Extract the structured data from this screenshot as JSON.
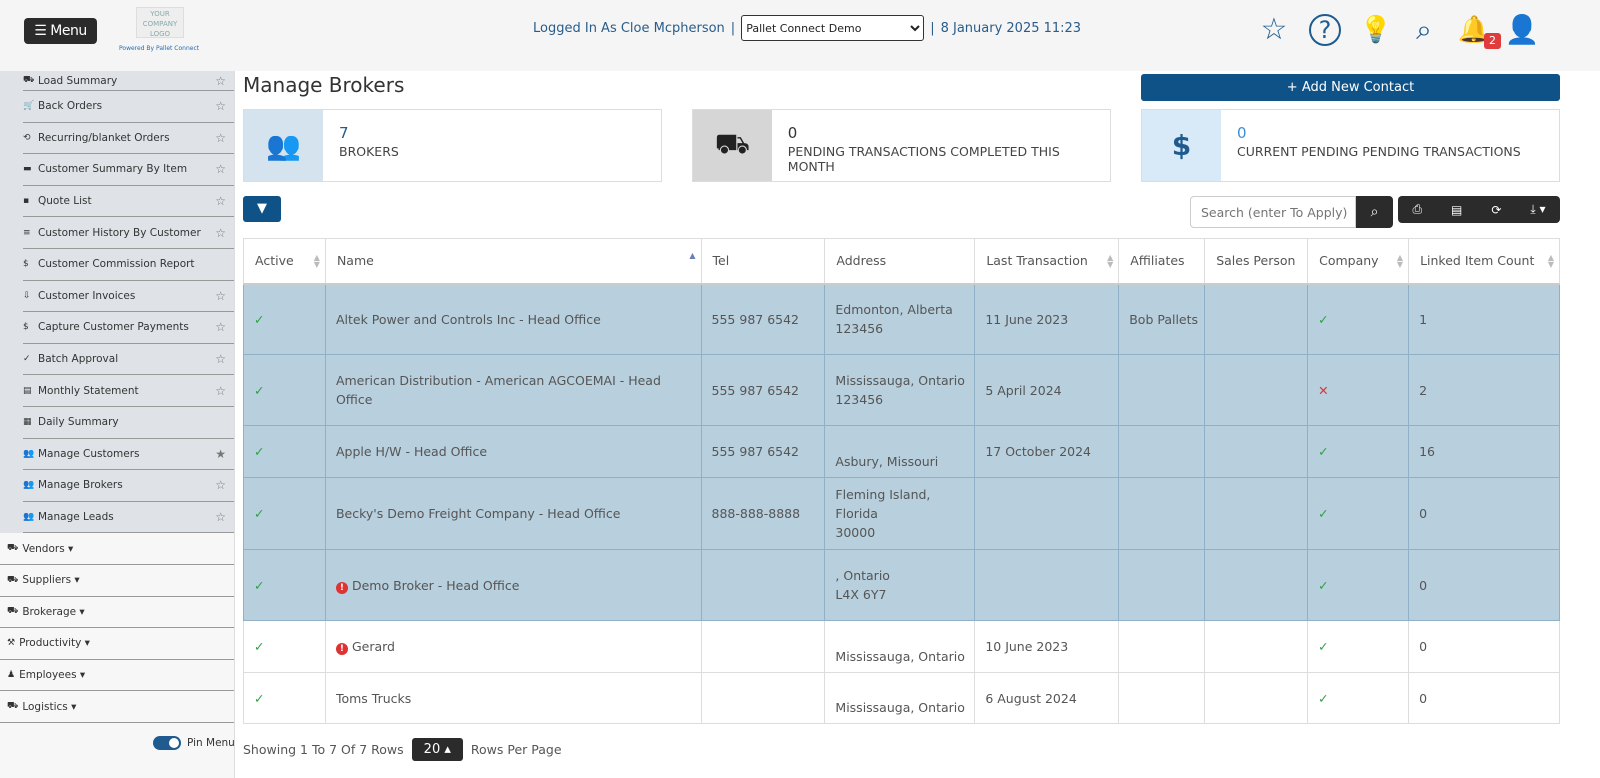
{
  "header": {
    "menu_label": "☰ Menu",
    "logo_text": "YOUR COMPANY LOGO",
    "powered_by": "Powered By Pallet Connect",
    "logged_in": "Logged In As Cloe Mcpherson",
    "company": "Pallet Connect Demo",
    "datetime": "8 January 2025 11:23",
    "notification_count": "2"
  },
  "sidebar": {
    "items": [
      {
        "icon": "⛟",
        "label": "Load Summary",
        "star": "☆"
      },
      {
        "icon": "🛒",
        "label": "Back Orders",
        "star": "☆"
      },
      {
        "icon": "⟲",
        "label": "Recurring/blanket Orders",
        "star": "☆"
      },
      {
        "icon": "▬",
        "label": "Customer Summary By Item",
        "star": "☆"
      },
      {
        "icon": "▪",
        "label": "Quote List",
        "star": "☆"
      },
      {
        "icon": "≡",
        "label": "Customer History By Customer",
        "star": "☆"
      },
      {
        "icon": "$",
        "label": "Customer Commission Report",
        "star": ""
      },
      {
        "icon": "⇩",
        "label": "Customer Invoices",
        "star": "☆"
      },
      {
        "icon": "$",
        "label": "Capture Customer Payments",
        "star": "☆"
      },
      {
        "icon": "✓",
        "label": "Batch Approval",
        "star": "☆"
      },
      {
        "icon": "▤",
        "label": "Monthly Statement",
        "star": "☆"
      },
      {
        "icon": "▦",
        "label": "Daily Summary",
        "star": ""
      },
      {
        "icon": "👥",
        "label": "Manage Customers",
        "star": "★"
      },
      {
        "icon": "👥",
        "label": "Manage Brokers",
        "star": "☆"
      },
      {
        "icon": "👥",
        "label": "Manage Leads",
        "star": "☆"
      }
    ],
    "groups": [
      {
        "icon": "⛟",
        "label": "Vendors ▾"
      },
      {
        "icon": "⛟",
        "label": "Suppliers ▾"
      },
      {
        "icon": "⛟",
        "label": "Brokerage ▾"
      },
      {
        "icon": "⚒",
        "label": "Productivity ▾"
      },
      {
        "icon": "♟",
        "label": "Employees ▾"
      },
      {
        "icon": "⛟",
        "label": "Logistics ▾"
      }
    ],
    "pin_label": "Pin Menu"
  },
  "page": {
    "title": "Manage Brokers",
    "add_label": "+ Add New Contact",
    "search_placeholder": "Search (enter To Apply)"
  },
  "cards": [
    {
      "num": "7",
      "label": "BROKERS"
    },
    {
      "num": "0",
      "label": "PENDING TRANSACTIONS COMPLETED THIS MONTH"
    },
    {
      "num": "0",
      "label": "CURRENT PENDING PENDING TRANSACTIONS"
    }
  ],
  "table": {
    "columns": [
      "Active",
      "Name",
      "Tel",
      "Address",
      "Last Transaction",
      "Affiliates",
      "Sales Person",
      "Company",
      "Linked Item Count"
    ],
    "rows": [
      {
        "hl": true,
        "active": "✓",
        "warn": false,
        "name": "Altek Power and Controls Inc - Head Office",
        "tel": "555 987 6542",
        "addr1": "Edmonton, Alberta",
        "addr2": "123456",
        "last": "11 June 2023",
        "aff": "Bob Pallets",
        "sales": "",
        "company": "✓",
        "linked": "1"
      },
      {
        "hl": true,
        "active": "✓",
        "warn": false,
        "name": "American Distribution - American AGCOEMAI - Head Office",
        "tel": "555 987 6542",
        "addr1": "Mississauga, Ontario",
        "addr2": "123456",
        "last": "5 April 2024",
        "aff": "",
        "sales": "",
        "company": "✕",
        "linked": "2"
      },
      {
        "hl": true,
        "active": "✓",
        "warn": false,
        "name": "Apple H/W - Head Office",
        "tel": "555 987 6542",
        "addr1": "",
        "addr2": "Asbury, Missouri",
        "last": "17 October 2024",
        "aff": "",
        "sales": "",
        "company": "✓",
        "linked": "16"
      },
      {
        "hl": true,
        "active": "✓",
        "warn": false,
        "name": "Becky's Demo Freight Company - Head Office",
        "tel": "888-888-8888",
        "addr1": "Fleming Island, Florida",
        "addr2": "30000",
        "last": "",
        "aff": "",
        "sales": "",
        "company": "✓",
        "linked": "0"
      },
      {
        "hl": true,
        "active": "✓",
        "warn": true,
        "name": "Demo Broker - Head Office",
        "tel": "",
        "addr1": ", Ontario",
        "addr2": "L4X 6Y7",
        "last": "",
        "aff": "",
        "sales": "",
        "company": "✓",
        "linked": "0"
      },
      {
        "hl": false,
        "active": "✓",
        "warn": true,
        "name": "Gerard",
        "tel": "",
        "addr1": "",
        "addr2": "Mississauga, Ontario",
        "last": "10 June 2023",
        "aff": "",
        "sales": "",
        "company": "✓",
        "linked": "0"
      },
      {
        "hl": false,
        "active": "✓",
        "warn": false,
        "name": "Toms Trucks",
        "tel": "",
        "addr1": "",
        "addr2": "Mississauga, Ontario",
        "last": "6 August 2024",
        "aff": "",
        "sales": "",
        "company": "✓",
        "linked": "0"
      }
    ]
  },
  "footer": {
    "showing": "Showing 1 To 7 Of 7 Rows",
    "rows_per_page": "20 ▴",
    "rows_label": "Rows Per Page"
  },
  "colors": {
    "primary": "#0f5287",
    "highlight": "#b8cfdd",
    "ok": "#2ea043",
    "error": "#dd3333"
  }
}
